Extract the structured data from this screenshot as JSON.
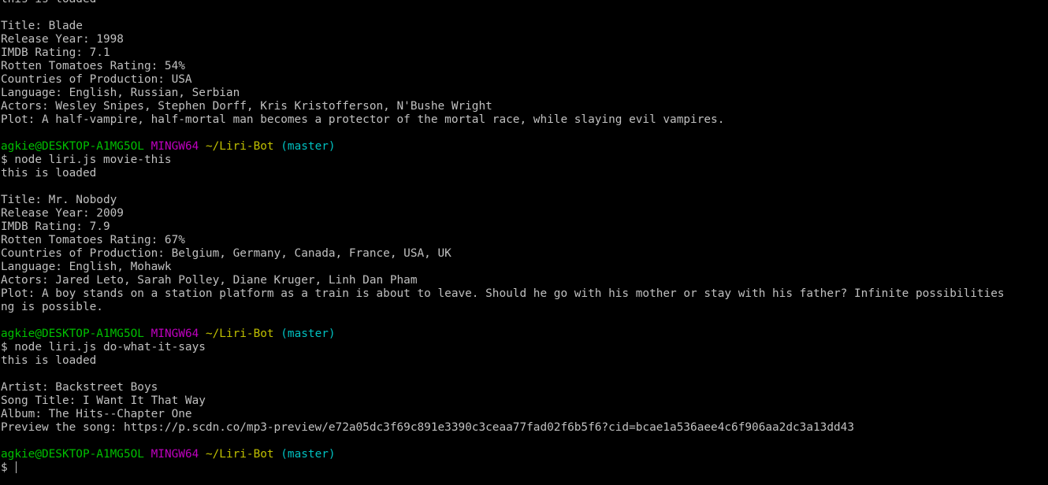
{
  "colors": {
    "background": "#000000",
    "text": "#c0c0c0",
    "user_host": "#00c000",
    "msystem": "#c000c0",
    "cwd": "#c0c000",
    "git_branch": "#00c0c0"
  },
  "prompt": {
    "user_host": "agkie@DESKTOP-A1MG5OL",
    "msystem": "MINGW64",
    "cwd": "~/Liri-Bot",
    "branch": "(master)",
    "symbol": "$"
  },
  "output": {
    "loaded_top": "this is loaded",
    "movie1": {
      "title": "Title: Blade",
      "year": "Release Year: 1998",
      "imdb": "IMDB Rating: 7.1",
      "rt": "Rotten Tomatoes Rating: 54%",
      "countries": "Countries of Production: USA",
      "language": "Language: English, Russian, Serbian",
      "actors": "Actors: Wesley Snipes, Stephen Dorff, Kris Kristofferson, N'Bushe Wright",
      "plot": "Plot: A half-vampire, half-mortal man becomes a protector of the mortal race, while slaying evil vampires."
    },
    "cmd1": "$ node liri.js movie-this",
    "loaded_1": "this is loaded",
    "movie2": {
      "title": "Title: Mr. Nobody",
      "year": "Release Year: 2009",
      "imdb": "IMDB Rating: 7.9",
      "rt": "Rotten Tomatoes Rating: 67%",
      "countries": "Countries of Production: Belgium, Germany, Canada, France, USA, UK",
      "language": "Language: English, Mohawk",
      "actors": "Actors: Jared Leto, Sarah Polley, Diane Kruger, Linh Dan Pham",
      "plot_line1": "Plot: A boy stands on a station platform as a train is about to leave. Should he go with his mother or stay with his father? Infinite possibilities",
      "plot_line2": "ng is possible."
    },
    "cmd2": "$ node liri.js do-what-it-says",
    "loaded_2": "this is loaded",
    "song": {
      "artist": "Artist: Backstreet Boys",
      "title": "Song Title: I Want It That Way",
      "album": "Album: The Hits--Chapter One",
      "preview": "Preview the song: https://p.scdn.co/mp3-preview/e72a05dc3f69c891e3390c3ceaa77fad02f6b5f6?cid=bcae1a536aee4c6f906aa2dc3a13dd43"
    }
  }
}
